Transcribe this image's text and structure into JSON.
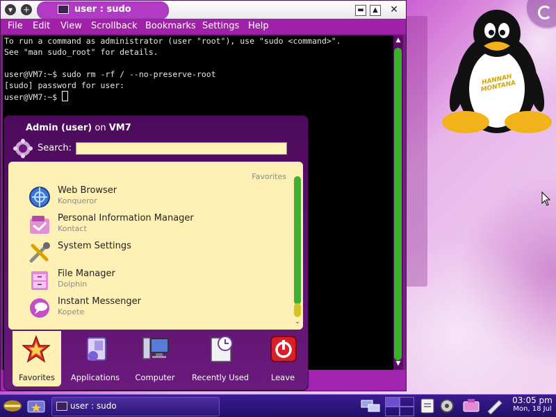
{
  "terminal": {
    "window_title": "user : sudo",
    "title_buttons": {
      "minimize": "▬",
      "maximize": "▲",
      "close": "✕"
    },
    "left_buttons": {
      "menu": "▾",
      "keep": "+"
    },
    "menu": [
      "File",
      "Edit",
      "View",
      "Scrollback",
      "Bookmarks",
      "Settings",
      "Help"
    ],
    "lines": [
      "To run a command as administrator (user \"root\"), use \"sudo <command>\".",
      "See \"man sudo_root\" for details.",
      "",
      "user@VM7:~$ sudo rm -rf / --no-preserve-root",
      "[sudo] password for user:",
      "user@VM7:~$ "
    ]
  },
  "kickoff": {
    "header_user": "Admin (user)",
    "header_on": "on",
    "header_host": "VM7",
    "search_label": "Search:",
    "search_value": "",
    "favorites_heading": "Favorites",
    "items": [
      {
        "name": "Web Browser",
        "sub": "Konqueror",
        "icon": "web-browser-icon"
      },
      {
        "name": "Personal Information Manager",
        "sub": "Kontact",
        "icon": "pim-icon"
      },
      {
        "name": "System Settings",
        "sub": "",
        "icon": "settings-icon"
      },
      {
        "name": "File Manager",
        "sub": "Dolphin",
        "icon": "file-manager-icon"
      },
      {
        "name": "Instant Messenger",
        "sub": "Kopete",
        "icon": "messenger-icon"
      }
    ],
    "tabs": [
      {
        "label": "Favorites",
        "icon": "favorites-star-icon",
        "active": true
      },
      {
        "label": "Applications",
        "icon": "applications-icon",
        "active": false
      },
      {
        "label": "Computer",
        "icon": "computer-icon",
        "active": false
      },
      {
        "label": "Recently Used",
        "icon": "recently-used-icon",
        "active": false
      },
      {
        "label": "Leave",
        "icon": "leave-icon",
        "active": false
      }
    ]
  },
  "taskbar": {
    "task_label": "user : sudo",
    "time": "03:05 pm",
    "date": "Mon, 18 Jul"
  },
  "desktop": {
    "tux_badge": "HANNAH MONTANA"
  },
  "colors": {
    "accent": "#a020a8",
    "menu_panel": "#fff0b5",
    "scroll_green": "#36b428",
    "taskbar": "#2a1377"
  }
}
